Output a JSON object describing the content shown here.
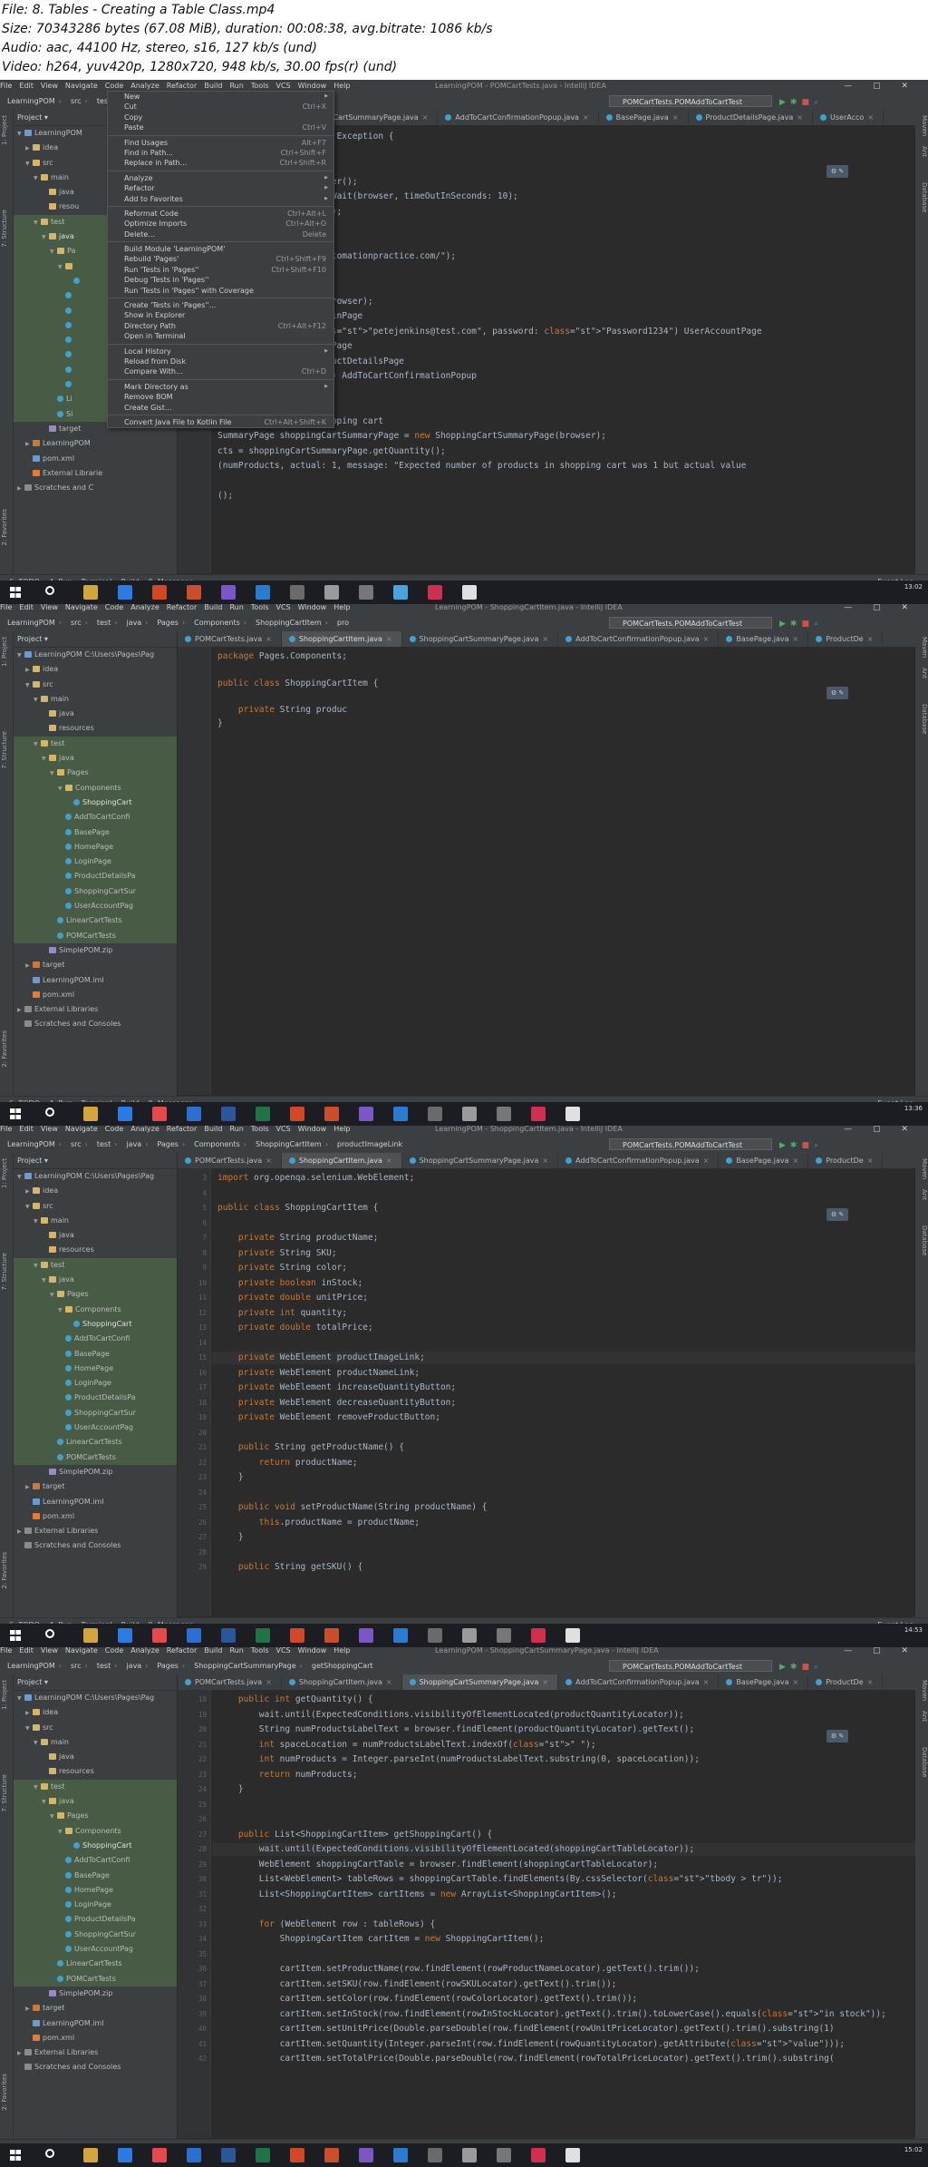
{
  "header": {
    "file": "File: 8. Tables - Creating a Table Class.mp4",
    "size": "Size: 70343286 bytes (67.08 MiB), duration: 00:08:38, avg.bitrate: 1086 kb/s",
    "audio": "Audio: aac, 44100 Hz, stereo, s16, 127 kb/s (und)",
    "video": "Video: h264, yuv420p, 1280x720, 948 kb/s, 30.00 fps(r) (und)"
  },
  "menu": [
    "File",
    "Edit",
    "View",
    "Navigate",
    "Code",
    "Analyze",
    "Refactor",
    "Build",
    "Run",
    "Tools",
    "VCS",
    "Window",
    "Help"
  ],
  "run_config": "POMCartTests.POMAddToCartTest",
  "project_label": "Project",
  "frames": [
    {
      "window_title": "LearningPOM - POMCartTests.java - IntelliJ IDEA",
      "breadcrumbs": [
        "LearningPOM",
        "src",
        "test",
        "java",
        "POMCartTests"
      ],
      "tabs": [
        "POMCartTests.java",
        "ShoppingCartSummaryPage.java",
        "AddToCartConfirmationPopup.java",
        "BasePage.java",
        "ProductDetailsPage.java",
        "UserAcco"
      ],
      "tree": [
        "LearningPOM",
        "idea",
        "src",
        "main",
        "java",
        "resou",
        "test",
        "java",
        "Pa",
        "",
        "",
        "",
        "",
        "",
        "",
        "",
        "",
        "",
        "Li",
        "Si",
        "target",
        "LearningPOM",
        "pom.xml",
        "External Librarie",
        "Scratches and C"
      ],
      "code": [
        "AddToCartTest() throws Exception {",
        "",
        "ation",
        "owser = new ChromeDriver();",
        "t wait = new WebDriverWait(browser, timeOutInSeconds: 10);",
        "e().window().maximize();",
        "",
        "site",
        "(\"http://automationpractice.com/\");",
        "",
        "to login page",
        "ePage = new HomePage(browser);",
        "igateToLoginPage() LoginPage",
        "in( emailAddress: \"petejenkins@test.com\", password: \"Password1234\") UserAccountPage",
        "igateToHomePage() HomePage",
        "ectFirstProduct() ProductDetailsPage",
        "ProductToShoppingCart() AddToCartConfirmationPopup",
        "ceedToCheckout();",
        "",
        "have 1 item in the shopping cart",
        "SummaryPage shoppingCartSummaryPage = new ShoppingCartSummaryPage(browser);",
        "cts = shoppingCartSummaryPage.getQuantity();",
        "(numProducts, actual: 1, message: \"Expected number of products in shopping cart was 1 but actual value",
        "",
        "();"
      ],
      "context_menu": [
        {
          "label": "New",
          "shortcut": ""
        },
        {
          "label": "Cut",
          "shortcut": "Ctrl+X"
        },
        {
          "label": "Copy",
          "shortcut": ""
        },
        {
          "label": "Paste",
          "shortcut": "Ctrl+V"
        },
        {
          "label": "Find Usages",
          "shortcut": "Alt+F7"
        },
        {
          "label": "Find in Path...",
          "shortcut": "Ctrl+Shift+F"
        },
        {
          "label": "Replace in Path...",
          "shortcut": "Ctrl+Shift+R"
        },
        {
          "label": "Analyze",
          "shortcut": ""
        },
        {
          "label": "Refactor",
          "shortcut": ""
        },
        {
          "label": "Add to Favorites",
          "shortcut": ""
        },
        {
          "label": "Reformat Code",
          "shortcut": "Ctrl+Alt+L"
        },
        {
          "label": "Optimize Imports",
          "shortcut": "Ctrl+Alt+O"
        },
        {
          "label": "Delete...",
          "shortcut": "Delete"
        },
        {
          "label": "Build Module 'LearningPOM'",
          "shortcut": ""
        },
        {
          "label": "Rebuild 'Pages'",
          "shortcut": "Ctrl+Shift+F9"
        },
        {
          "label": "Run 'Tests in 'Pages''",
          "shortcut": "Ctrl+Shift+F10"
        },
        {
          "label": "Debug 'Tests in 'Pages''",
          "shortcut": ""
        },
        {
          "label": "Run 'Tests in 'Pages'' with Coverage",
          "shortcut": ""
        },
        {
          "label": "Create 'Tests in 'Pages''...",
          "shortcut": ""
        },
        {
          "label": "Show in Explorer",
          "shortcut": ""
        },
        {
          "label": "Directory Path",
          "shortcut": "Ctrl+Alt+F12"
        },
        {
          "label": "Open in Terminal",
          "shortcut": ""
        },
        {
          "label": "Local History",
          "shortcut": ""
        },
        {
          "label": "Reload from Disk",
          "shortcut": ""
        },
        {
          "label": "Compare With...",
          "shortcut": "Ctrl+D"
        },
        {
          "label": "Mark Directory as",
          "shortcut": ""
        },
        {
          "label": "Remove BOM",
          "shortcut": ""
        },
        {
          "label": "Create Gist...",
          "shortcut": ""
        },
        {
          "label": "Convert Java File to Kotlin File",
          "shortcut": "Ctrl+Alt+Shift+K"
        }
      ],
      "status": "Tests passed: 1 (yesterd",
      "position": "2:1  CRLF  UTF-8  4 spaces",
      "clock": "13:02"
    },
    {
      "window_title": "LearningPOM - ShoppingCartItem.java - IntelliJ IDEA",
      "breadcrumbs": [
        "LearningPOM",
        "src",
        "test",
        "java",
        "Pages",
        "Components",
        "ShoppingCartItem",
        "pro"
      ],
      "tabs": [
        "POMCartTests.java",
        "ShoppingCartItem.java",
        "ShoppingCartSummaryPage.java",
        "AddToCartConfirmationPopup.java",
        "BasePage.java",
        "ProductDe"
      ],
      "tree": [
        "LearningPOM C:\\Users\\Pages\\Pag",
        "idea",
        "src",
        "main",
        "java",
        "resources",
        "test",
        "java",
        "Pages",
        "Components",
        "ShoppingCart",
        "AddToCartConfi",
        "BasePage",
        "HomePage",
        "LoginPage",
        "ProductDetailsPa",
        "ShoppingCartSur",
        "UserAccountPag",
        "LinearCartTests",
        "POMCartTests",
        "SimplePOM.zip",
        "target",
        "LearningPOM.iml",
        "pom.xml",
        "External Libraries",
        "Scratches and Consoles"
      ],
      "code": [
        "package Pages.Components;",
        "",
        "public class ShoppingCartItem {",
        "",
        "    private String produc",
        "}"
      ],
      "status": "Tests passed: 1 (yesterday 18:18)",
      "position": "5:26  CRLF  UTF-8  4 spaces",
      "clock": "13:36"
    },
    {
      "window_title": "LearningPOM - ShoppingCartItem.java - IntelliJ IDEA",
      "breadcrumbs": [
        "LearningPOM",
        "src",
        "test",
        "java",
        "Pages",
        "Components",
        "ShoppingCartItem",
        "productImageLink"
      ],
      "tabs": [
        "POMCartTests.java",
        "ShoppingCartItem.java",
        "ShoppingCartSummaryPage.java",
        "AddToCartConfirmationPopup.java",
        "BasePage.java",
        "ProductDe"
      ],
      "tree": [
        "LearningPOM C:\\Users\\Pages\\Pag",
        "idea",
        "src",
        "main",
        "java",
        "resources",
        "test",
        "java",
        "Pages",
        "Components",
        "ShoppingCart",
        "AddToCartConfi",
        "BasePage",
        "HomePage",
        "LoginPage",
        "ProductDetailsPa",
        "ShoppingCartSur",
        "UserAccountPag",
        "LinearCartTests",
        "POMCartTests",
        "SimplePOM.zip",
        "target",
        "LearningPOM.iml",
        "pom.xml",
        "External Libraries",
        "Scratches and Consoles"
      ],
      "code": [
        "import org.openqa.selenium.WebElement;",
        "",
        "public class ShoppingCartItem {",
        "",
        "    private String productName;",
        "    private String SKU;",
        "    private String color;",
        "    private boolean inStock;",
        "    private double unitPrice;",
        "    private int quantity;",
        "    private double totalPrice;",
        "",
        "    private WebElement productImageLink;",
        "    private WebElement productNameLink;",
        "    private WebElement increaseQuantityButton;",
        "    private WebElement decreaseQuantityButton;",
        "    private WebElement removeProductButton;",
        "",
        "    public String getProductName() {",
        "        return productName;",
        "    }",
        "",
        "    public void setProductName(String productName) {",
        "        this.productName = productName;",
        "    }",
        "",
        "    public String getSKU() {"
      ],
      "line_numbers": [
        "3",
        "4",
        "5",
        "6",
        "7",
        "8",
        "9",
        "10",
        "11",
        "12",
        "13",
        "14",
        "15",
        "16",
        "17",
        "18",
        "19",
        "20",
        "21",
        "22",
        "23",
        "24",
        "25",
        "26",
        "27",
        "28",
        "29"
      ],
      "status": "Tests passed: 1 (yesterday 18:18)",
      "position": "10 chars  15:13  CRLF  UTF-8  4 spaces",
      "clock": "14:53"
    },
    {
      "window_title": "LearningPOM - ShoppingCartSummaryPage.java - IntelliJ IDEA",
      "breadcrumbs": [
        "LearningPOM",
        "src",
        "test",
        "java",
        "Pages",
        "ShoppingCartSummaryPage",
        "getShoppingCart"
      ],
      "tabs": [
        "POMCartTests.java",
        "ShoppingCartItem.java",
        "ShoppingCartSummaryPage.java",
        "AddToCartConfirmationPopup.java",
        "BasePage.java",
        "ProductDe"
      ],
      "tree": [
        "LearningPOM C:\\Users\\Pages\\Pag",
        "idea",
        "src",
        "main",
        "java",
        "resources",
        "test",
        "java",
        "Pages",
        "Components",
        "ShoppingCart",
        "AddToCartConfi",
        "BasePage",
        "HomePage",
        "LoginPage",
        "ProductDetailsPa",
        "ShoppingCartSur",
        "UserAccountPag",
        "LinearCartTests",
        "POMCartTests",
        "SimplePOM.zip",
        "target",
        "LearningPOM.iml",
        "pom.xml",
        "External Libraries",
        "Scratches and Consoles"
      ],
      "code": [
        "    public int getQuantity() {",
        "        wait.until(ExpectedConditions.visibilityOfElementLocated(productQuantityLocator));",
        "        String numProductsLabelText = browser.findElement(productQuantityLocator).getText();",
        "        int spaceLocation = numProductsLabelText.indexOf(\" \");",
        "        int numProducts = Integer.parseInt(numProductsLabelText.substring(0, spaceLocation));",
        "        return numProducts;",
        "    }",
        "",
        "",
        "    public List<ShoppingCartItem> getShoppingCart() {",
        "        wait.until(ExpectedConditions.visibilityOfElementLocated(shoppingCartTableLocator));",
        "        WebElement shoppingCartTable = browser.findElement(shoppingCartTableLocator);",
        "        List<WebElement> tableRows = shoppingCartTable.findElements(By.cssSelector(\"tbody > tr\"));",
        "        List<ShoppingCartItem> cartItems = new ArrayList<ShoppingCartItem>();",
        "",
        "        for (WebElement row : tableRows) {",
        "            ShoppingCartItem cartItem = new ShoppingCartItem();",
        "",
        "            cartItem.setProductName(row.findElement(rowProductNameLocator).getText().trim());",
        "            cartItem.setSKU(row.findElement(rowSKULocator).getText().trim());",
        "            cartItem.setColor(row.findElement(rowColorLocator).getText().trim());",
        "            cartItem.setInStock(row.findElement(rowInStockLocator).getText().trim().toLowerCase().equals(\"in stock\"));",
        "            cartItem.setUnitPrice(Double.parseDouble(row.findElement(rowUnitPriceLocator).getText().trim().substring(1)",
        "            cartItem.setQuantity(Integer.parseInt(row.findElement(rowQuantityLocator).getAttribute(\"value\")));",
        "            cartItem.setTotalPrice(Double.parseDouble(row.findElement(rowTotalPriceLocator).getText().trim().substring("
      ],
      "line_numbers": [
        "18",
        "19",
        "20",
        "21",
        "22",
        "23",
        "24",
        "25",
        "26",
        "27",
        "28",
        "29",
        "30",
        "31",
        "32",
        "33",
        "34",
        "35",
        "36",
        "37",
        "38",
        "39",
        "40",
        "41",
        "42"
      ],
      "status": "Method 'getShoppingCart()' is never used",
      "position": "27:35  CRLF  UTF-8  4 spaces",
      "clock": "15:02"
    }
  ],
  "bottom_tools": [
    "6: TODO",
    "4: Run",
    "Terminal",
    "Build",
    "0: Messages"
  ],
  "event_log": "Event Log",
  "side_labels": [
    "1: Project",
    "7: Structure",
    "2: Favorites"
  ],
  "right_labels": [
    "Maven",
    "Ant",
    "Database"
  ],
  "colors": {
    "ide_bg": "#2b2b2b",
    "panel": "#3c3f41",
    "selection": "#0d293e",
    "green_row": "#485c45",
    "keyword": "#cc7832",
    "string": "#6a8759",
    "field": "#9876aa",
    "taskbar": "#1c1d22"
  }
}
